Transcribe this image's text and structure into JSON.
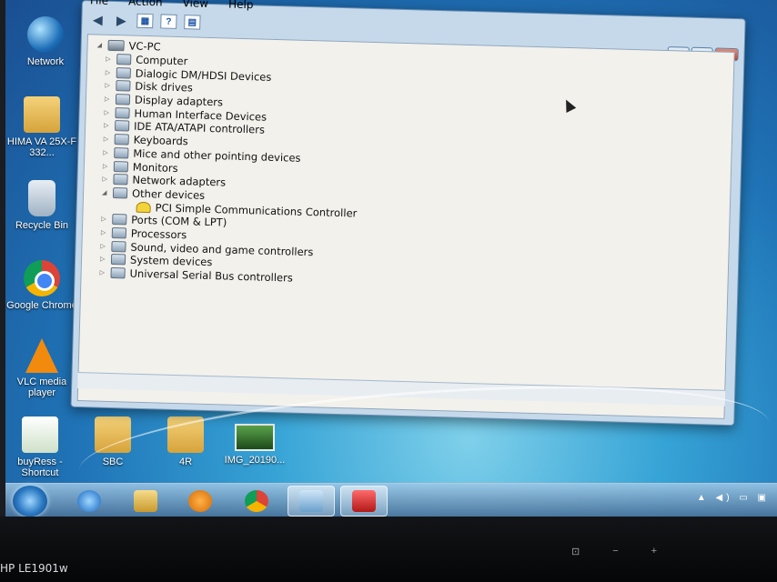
{
  "desktop": {
    "icons": [
      {
        "label": "Network"
      },
      {
        "label": "HIMA VA 25X-F 332..."
      },
      {
        "label": "Recycle Bin"
      },
      {
        "label": "Google Chrome"
      },
      {
        "label": "VLC media player"
      },
      {
        "label": "buyRess - Shortcut"
      },
      {
        "label": "SBC"
      },
      {
        "label": "4R"
      },
      {
        "label": "IMG_20190..."
      }
    ]
  },
  "window": {
    "menu": [
      "File",
      "Action",
      "View",
      "Help"
    ],
    "toolbar_icons": [
      "back-arrow-icon",
      "forward-arrow-icon",
      "properties-icon",
      "help-icon",
      "console-icon"
    ],
    "tree": {
      "root": "VC-PC",
      "items": [
        {
          "label": "Computer",
          "level": 1,
          "expanded": false
        },
        {
          "label": "Dialogic DM/HDSI Devices",
          "level": 1,
          "expanded": false
        },
        {
          "label": "Disk drives",
          "level": 1,
          "expanded": false
        },
        {
          "label": "Display adapters",
          "level": 1,
          "expanded": false
        },
        {
          "label": "Human Interface Devices",
          "level": 1,
          "expanded": false
        },
        {
          "label": "IDE ATA/ATAPI controllers",
          "level": 1,
          "expanded": false
        },
        {
          "label": "Keyboards",
          "level": 1,
          "expanded": false
        },
        {
          "label": "Mice and other pointing devices",
          "level": 1,
          "expanded": false
        },
        {
          "label": "Monitors",
          "level": 1,
          "expanded": false
        },
        {
          "label": "Network adapters",
          "level": 1,
          "expanded": false
        },
        {
          "label": "Other devices",
          "level": 1,
          "expanded": true
        },
        {
          "label": "PCI Simple Communications Controller",
          "level": 2,
          "warning": true
        },
        {
          "label": "Ports (COM & LPT)",
          "level": 1,
          "expanded": false
        },
        {
          "label": "Processors",
          "level": 1,
          "expanded": false
        },
        {
          "label": "Sound, video and game controllers",
          "level": 1,
          "expanded": false
        },
        {
          "label": "System devices",
          "level": 1,
          "expanded": false
        },
        {
          "label": "Universal Serial Bus controllers",
          "level": 1,
          "expanded": false
        }
      ]
    }
  },
  "taskbar": {
    "items": [
      "start-orb",
      "internet-explorer-icon",
      "windows-explorer-icon",
      "media-player-icon",
      "chrome-icon",
      "device-manager-icon",
      "toolbox-icon"
    ]
  },
  "monitor": {
    "brand_label": "HP LE1901w"
  }
}
